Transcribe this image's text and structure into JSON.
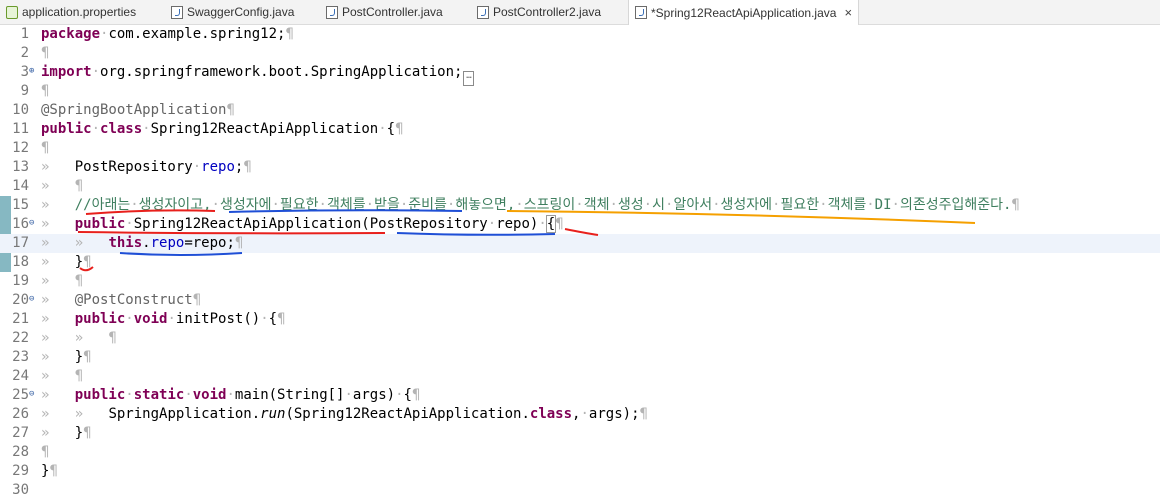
{
  "tabs": [
    {
      "label": "application.properties",
      "icon": "properties-file-icon",
      "active": false
    },
    {
      "label": "SwaggerConfig.java",
      "icon": "java-file-icon",
      "active": false
    },
    {
      "label": "PostController.java",
      "icon": "java-file-icon",
      "active": false
    },
    {
      "label": "PostController2.java",
      "icon": "java-file-icon",
      "active": false
    },
    {
      "label": "*Spring12ReactApiApplication.java",
      "icon": "java-file-icon",
      "active": true
    }
  ],
  "close_glyph": "×",
  "lines": [
    {
      "num": "1",
      "html": "<span class=\"kw\">package</span><span class=\"ws\">·</span>com.example.spring12;<span class=\"ws\">¶</span>"
    },
    {
      "num": "2",
      "html": "<span class=\"ws\">¶</span>"
    },
    {
      "num": "3",
      "html": "<span class=\"kw\">import</span><span class=\"ws\">·</span>org.springframework.boot.SpringApplication;<span class=\"ellipsis\">…</span>"
    },
    {
      "num": "9",
      "html": "<span class=\"ws\">¶</span>"
    },
    {
      "num": "10",
      "html": "<span class=\"ann\">@SpringBootApplication</span><span class=\"ws\">¶</span>"
    },
    {
      "num": "11",
      "html": "<span class=\"kw\">public</span><span class=\"ws\">·</span><span class=\"kw\">class</span><span class=\"ws\">·</span>Spring12ReactApiApplication<span class=\"ws\">·</span>{<span class=\"ws\">¶</span>"
    },
    {
      "num": "12",
      "html": "<span class=\"ws\">¶</span>"
    },
    {
      "num": "13",
      "html": "<span class=\"ws\">»   </span>PostRepository<span class=\"ws\">·</span><span class=\"fld\">repo</span>;<span class=\"ws\">¶</span>"
    },
    {
      "num": "14",
      "html": "<span class=\"ws\">»   ¶</span>"
    },
    {
      "num": "15",
      "html": "<span class=\"ws\">»   </span><span class=\"cm\">//아래는<span class=\"ws\">·</span>생성자이고,<span class=\"ws\">·</span>생성자에<span class=\"ws\">·</span>필요한<span class=\"ws\">·</span>객체를<span class=\"ws\">·</span>받을<span class=\"ws\">·</span>준비를<span class=\"ws\">·</span>해놓으면,<span class=\"ws\">·</span>스프링이<span class=\"ws\">·</span>객체<span class=\"ws\">·</span>생성<span class=\"ws\">·</span>시<span class=\"ws\">·</span>알아서<span class=\"ws\">·</span>생성자에<span class=\"ws\">·</span>필요한<span class=\"ws\">·</span>객체를<span class=\"ws\">·</span>DI<span class=\"ws\">·</span>의존성주입해준다.</span><span class=\"ws\">¶</span>"
    },
    {
      "num": "16",
      "html": "<span class=\"ws\">»   </span><span class=\"kw\">public</span><span class=\"ws\">·</span>Spring12ReactApiApplication(PostRepository<span class=\"ws\">·</span>repo)<span class=\"ws\">·</span><span class=\"brace-box\">{</span><span class=\"ws\">¶</span>"
    },
    {
      "num": "17",
      "html": "<span class=\"ws\">»   »   </span><span class=\"kw\">this</span>.<span class=\"fld\">repo</span>=repo;<span class=\"ws\">¶</span>"
    },
    {
      "num": "18",
      "html": "<span class=\"ws\">»   </span>}<span class=\"ws\">¶</span>"
    },
    {
      "num": "19",
      "html": "<span class=\"ws\">»   ¶</span>"
    },
    {
      "num": "20",
      "html": "<span class=\"ws\">»   </span><span class=\"ann\">@PostConstruct</span><span class=\"ws\">¶</span>"
    },
    {
      "num": "21",
      "html": "<span class=\"ws\">»   </span><span class=\"kw\">public</span><span class=\"ws\">·</span><span class=\"kw\">void</span><span class=\"ws\">·</span>initPost()<span class=\"ws\">·</span>{<span class=\"ws\">¶</span>"
    },
    {
      "num": "22",
      "html": "<span class=\"ws\">»   »   ¶</span>"
    },
    {
      "num": "23",
      "html": "<span class=\"ws\">»   </span>}<span class=\"ws\">¶</span>"
    },
    {
      "num": "24",
      "html": "<span class=\"ws\">»   ¶</span>"
    },
    {
      "num": "25",
      "html": "<span class=\"ws\">»   </span><span class=\"kw\">public</span><span class=\"ws\">·</span><span class=\"kw\">static</span><span class=\"ws\">·</span><span class=\"kw\">void</span><span class=\"ws\">·</span>main(String[]<span class=\"ws\">·</span>args)<span class=\"ws\">·</span>{<span class=\"ws\">¶</span>"
    },
    {
      "num": "26",
      "html": "<span class=\"ws\">»   »   </span>SpringApplication.<span class=\"it\">run</span>(Spring12ReactApiApplication.<span class=\"kw\">class</span>,<span class=\"ws\">·</span>args);<span class=\"ws\">¶</span>"
    },
    {
      "num": "27",
      "html": "<span class=\"ws\">»   </span>}<span class=\"ws\">¶</span>"
    },
    {
      "num": "28",
      "html": "<span class=\"ws\">¶</span>"
    },
    {
      "num": "29",
      "html": "}<span class=\"ws\">¶</span>"
    },
    {
      "num": "30",
      "html": ""
    }
  ],
  "annotation_colors": {
    "red": "#e8201c",
    "blue": "#1f4fd6",
    "orange": "#f5a000"
  }
}
